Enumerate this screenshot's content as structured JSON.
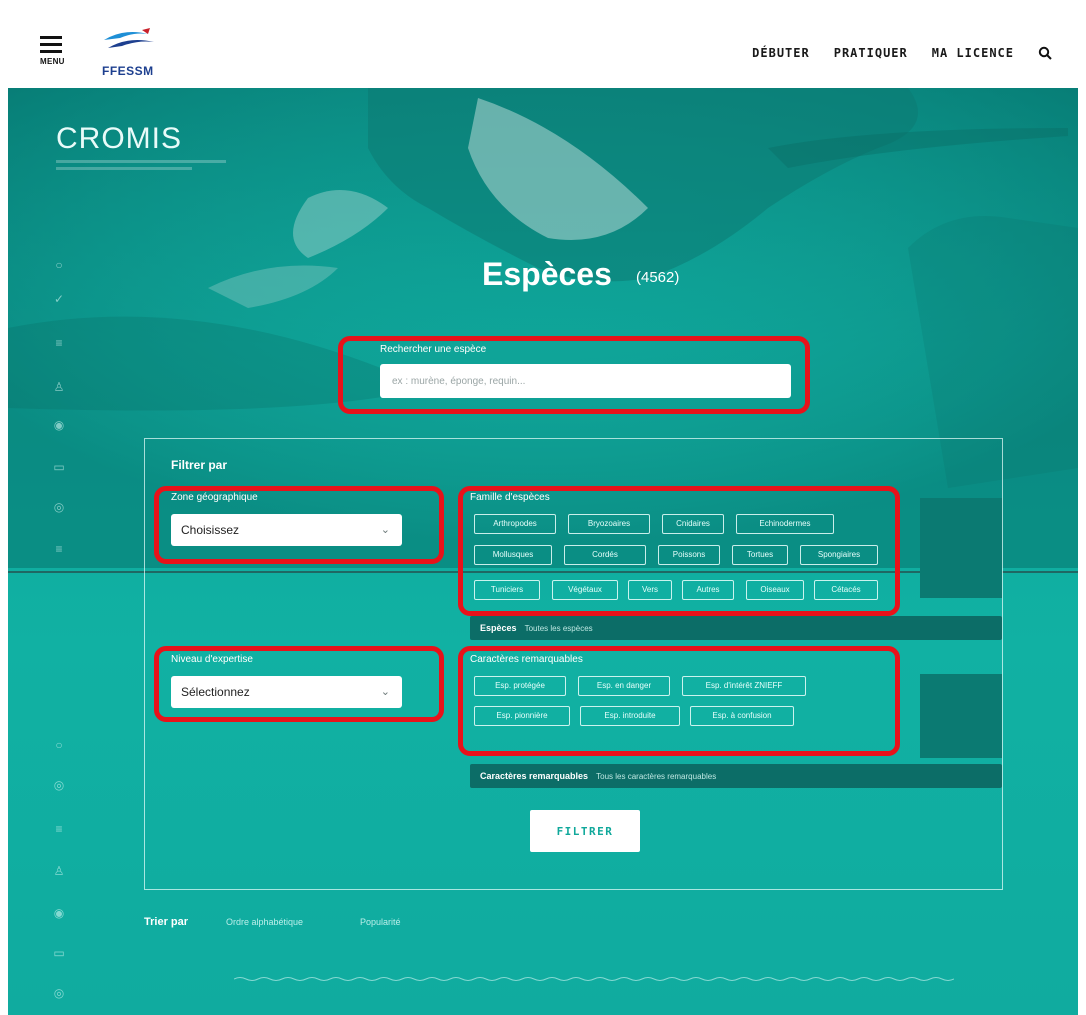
{
  "header": {
    "menu_label": "MENU",
    "logo_text": "FFESSM",
    "nav": [
      "DÉBUTER",
      "PRATIQUER",
      "MA LICENCE"
    ]
  },
  "brand": {
    "name": "CROMIS"
  },
  "page": {
    "title": "Espèces",
    "count": "(4562)"
  },
  "search": {
    "label": "Rechercher une espèce",
    "placeholder": "ex : murène, éponge, requin..."
  },
  "filters": {
    "heading": "Filtrer par",
    "zone": {
      "label": "Zone géographique",
      "value": "Choisissez"
    },
    "niveau": {
      "label": "Niveau d'expertise",
      "value": "Sélectionnez"
    },
    "famille": {
      "label": "Famille d'espèces",
      "tags": [
        "Arthropodes",
        "Bryozoaires",
        "Cnidaires",
        "Echinodermes",
        "Mollusques",
        "Cordés",
        "Poissons",
        "Tortues",
        "Spongiaires",
        "Tuniciers",
        "Végétaux",
        "Vers",
        "Autres",
        "Oiseaux",
        "Cétacés"
      ]
    },
    "especes_bar": {
      "label": "Espèces",
      "value": "Toutes les espèces"
    },
    "caracteres": {
      "label": "Caractères remarquables",
      "tags": [
        "Esp. protégée",
        "Esp. en danger",
        "Esp. d'intérêt ZNIEFF",
        "Esp. pionnière",
        "Esp. introduite",
        "Esp. à confusion"
      ]
    },
    "caracteres_bar": {
      "label": "Caractères remarquables",
      "value": "Tous les caractères remarquables"
    },
    "submit": "FILTRER"
  },
  "sort": {
    "label": "Trier par",
    "options": [
      "Ordre alphabétique",
      "Popularité"
    ]
  },
  "colors": {
    "teal": "#11b1a3",
    "highlight": "#e8121a",
    "brand_blue": "#1d3f8f"
  },
  "icons": [
    "menu-icon",
    "search-icon",
    "chevron-down-icon"
  ]
}
